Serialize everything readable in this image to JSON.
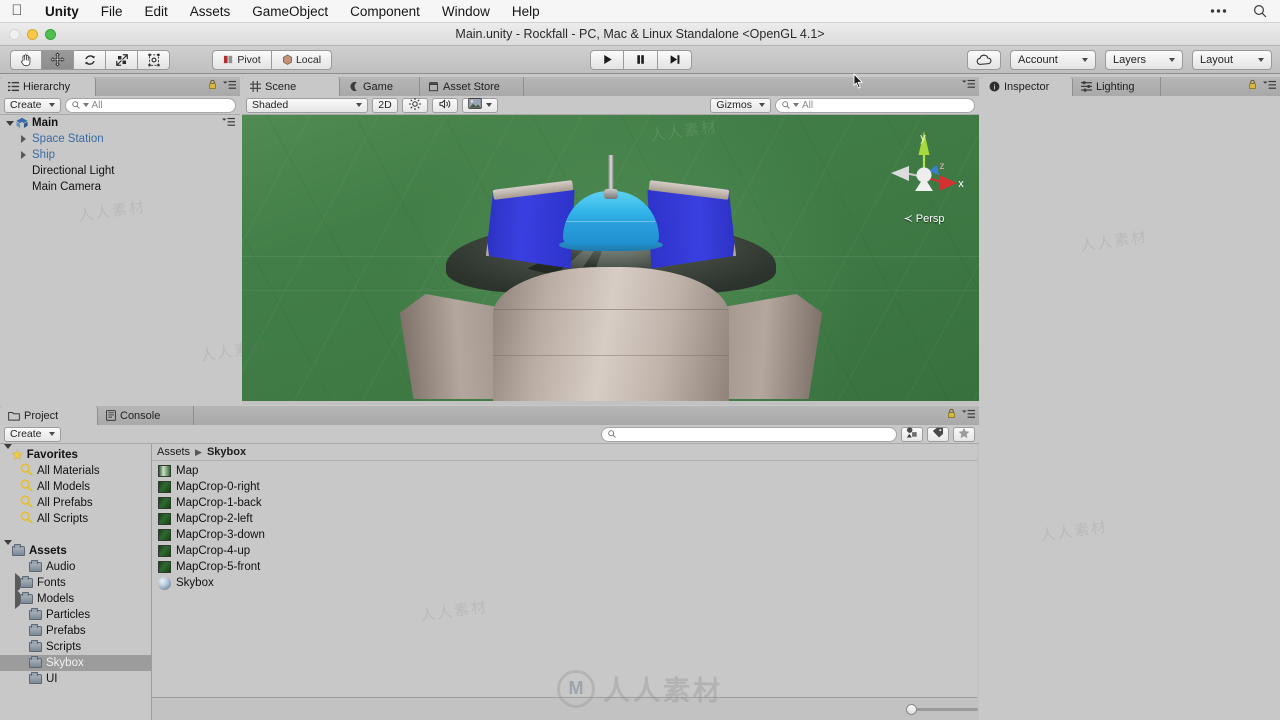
{
  "macmenu": {
    "apple_icon": "apple-icon",
    "items": [
      "Unity",
      "File",
      "Edit",
      "Assets",
      "GameObject",
      "Component",
      "Window",
      "Help"
    ],
    "right_icons": [
      "ellipsis-icon",
      "search-icon"
    ]
  },
  "window": {
    "title": "Main.unity - Rockfall - PC, Mac & Linux Standalone <OpenGL 4.1>",
    "traffic": [
      "close-button",
      "minimize-button",
      "zoom-button"
    ]
  },
  "toolbar": {
    "tools": [
      {
        "name": "hand-tool",
        "icon": "hand-icon",
        "active": false
      },
      {
        "name": "move-tool",
        "icon": "move-icon",
        "active": true
      },
      {
        "name": "rotate-tool",
        "icon": "rotate-icon",
        "active": false
      },
      {
        "name": "scale-tool",
        "icon": "scale-icon",
        "active": false
      },
      {
        "name": "rect-tool",
        "icon": "rect-transform-icon",
        "active": false
      }
    ],
    "pivot_label": "Pivot",
    "local_label": "Local",
    "play_label": "play-icon",
    "pause_label": "pause-icon",
    "step_label": "step-icon",
    "cloud_label": "cloud-icon",
    "account_label": "Account",
    "layers_label": "Layers",
    "layout_label": "Layout"
  },
  "hierarchy": {
    "tab_label": "Hierarchy",
    "create_label": "Create",
    "search_placeholder": "All",
    "root": {
      "label": "Main",
      "expanded": true
    },
    "items": [
      {
        "label": "Space Station",
        "expandable": true,
        "prefab": true,
        "indent": 1
      },
      {
        "label": "Ship",
        "expandable": true,
        "prefab": true,
        "indent": 1
      },
      {
        "label": "Directional Light",
        "expandable": false,
        "prefab": false,
        "indent": 1
      },
      {
        "label": "Main Camera",
        "expandable": false,
        "prefab": false,
        "indent": 1
      }
    ]
  },
  "scene": {
    "tabs": [
      {
        "label": "Scene",
        "icon": "scene-grid-icon",
        "active": true
      },
      {
        "label": "Game",
        "icon": "game-pad-icon",
        "active": false
      },
      {
        "label": "Asset Store",
        "icon": "store-icon",
        "active": false
      }
    ],
    "shading_mode": "Shaded",
    "mode_2d": "2D",
    "lighting_toggle": "lighting-icon",
    "audio_toggle": "audio-icon",
    "effects_toggle": "effects-icon",
    "gizmos_label": "Gizmos",
    "gizmo_search_placeholder": "All",
    "axis_labels": {
      "x": "x",
      "y": "y",
      "z": "z"
    },
    "projection_label": "Persp",
    "background_color": "#3f7a45"
  },
  "inspector": {
    "tabs": [
      {
        "label": "Inspector",
        "icon": "inspector-icon",
        "active": true
      },
      {
        "label": "Lighting",
        "icon": "lighting-settings-icon",
        "active": false
      }
    ],
    "lock_icon": "lock-icon",
    "menu_icon": "panel-menu-icon"
  },
  "project": {
    "tabs": [
      {
        "label": "Project",
        "icon": "folder-icon",
        "active": true
      },
      {
        "label": "Console",
        "icon": "console-icon",
        "active": false
      }
    ],
    "create_label": "Create",
    "search_placeholder": "",
    "filter_icons": [
      "type-filter-icon",
      "label-filter-icon",
      "favorite-filter-icon"
    ],
    "lock_icon": "lock-icon",
    "menu_icon": "panel-menu-icon",
    "tree": [
      {
        "label": "Favorites",
        "kind": "favorites-root",
        "indent": 0,
        "expanded": true,
        "bold": true,
        "selected": false
      },
      {
        "label": "All Materials",
        "kind": "saved-search",
        "indent": 1,
        "expanded": false,
        "bold": false,
        "selected": false
      },
      {
        "label": "All Models",
        "kind": "saved-search",
        "indent": 1,
        "expanded": false,
        "bold": false,
        "selected": false
      },
      {
        "label": "All Prefabs",
        "kind": "saved-search",
        "indent": 1,
        "expanded": false,
        "bold": false,
        "selected": false
      },
      {
        "label": "All Scripts",
        "kind": "saved-search",
        "indent": 1,
        "expanded": false,
        "bold": false,
        "selected": false
      },
      {
        "label": "",
        "kind": "spacer",
        "indent": 0,
        "expanded": false,
        "bold": false,
        "selected": false
      },
      {
        "label": "Assets",
        "kind": "folder",
        "indent": 0,
        "expanded": true,
        "bold": true,
        "selected": false
      },
      {
        "label": "Audio",
        "kind": "folder",
        "indent": 1,
        "expanded": false,
        "bold": false,
        "selected": false
      },
      {
        "label": "Fonts",
        "kind": "folder-expandable",
        "indent": 1,
        "expanded": false,
        "bold": false,
        "selected": false
      },
      {
        "label": "Models",
        "kind": "folder-expandable",
        "indent": 1,
        "expanded": false,
        "bold": false,
        "selected": false
      },
      {
        "label": "Particles",
        "kind": "folder",
        "indent": 1,
        "expanded": false,
        "bold": false,
        "selected": false
      },
      {
        "label": "Prefabs",
        "kind": "folder",
        "indent": 1,
        "expanded": false,
        "bold": false,
        "selected": false
      },
      {
        "label": "Scripts",
        "kind": "folder",
        "indent": 1,
        "expanded": false,
        "bold": false,
        "selected": false
      },
      {
        "label": "Skybox",
        "kind": "folder",
        "indent": 1,
        "expanded": false,
        "bold": false,
        "selected": true
      },
      {
        "label": "UI",
        "kind": "folder",
        "indent": 1,
        "expanded": false,
        "bold": false,
        "selected": false
      }
    ],
    "breadcrumb": [
      "Assets",
      "Skybox"
    ],
    "assets": [
      {
        "label": "Map",
        "icon": "texture-thumb-wide"
      },
      {
        "label": "MapCrop-0-right",
        "icon": "texture-thumb"
      },
      {
        "label": "MapCrop-1-back",
        "icon": "texture-thumb"
      },
      {
        "label": "MapCrop-2-left",
        "icon": "texture-thumb"
      },
      {
        "label": "MapCrop-3-down",
        "icon": "texture-thumb"
      },
      {
        "label": "MapCrop-4-up",
        "icon": "texture-thumb"
      },
      {
        "label": "MapCrop-5-front",
        "icon": "texture-thumb"
      },
      {
        "label": "Skybox",
        "icon": "material-sphere"
      }
    ],
    "zoom_slider_value": 8
  },
  "watermark": {
    "text": "人人素材",
    "logo": "M"
  }
}
